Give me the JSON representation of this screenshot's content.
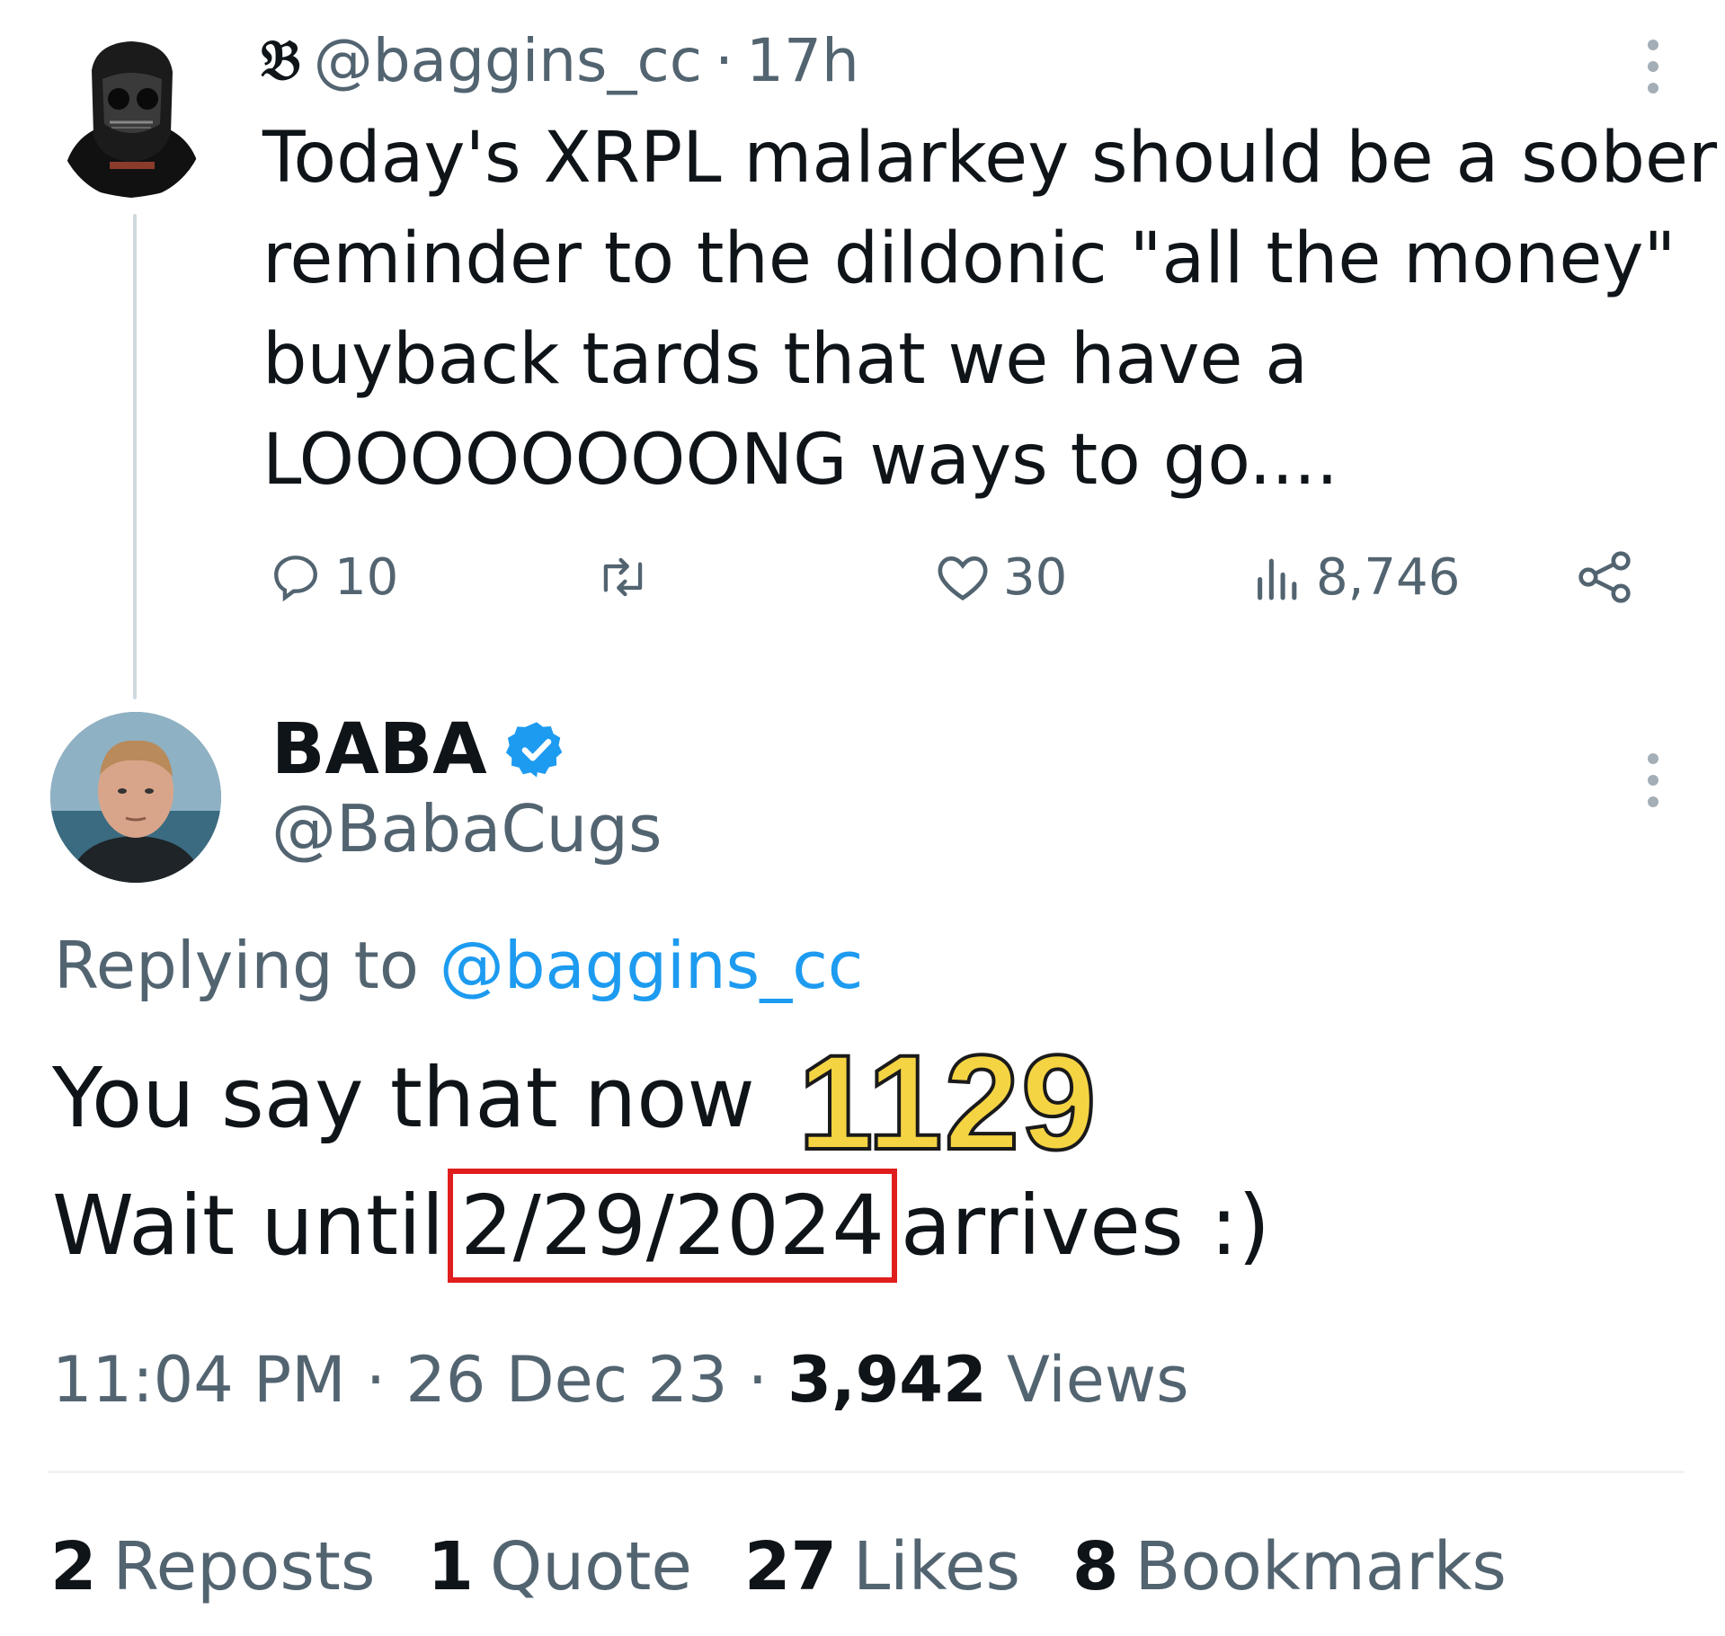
{
  "parent_tweet": {
    "brand_glyph": "𝔅",
    "handle": "@baggins_cc",
    "separator": "·",
    "time_ago": "17h",
    "text_lines": [
      "Today's XRPL malarkey should be a sober",
      "reminder to the dildonic \"all the money\"",
      "buyback tards that we have a",
      "LOOOOOOOONG ways to go...."
    ],
    "actions": {
      "replies": "10",
      "reposts": "",
      "likes": "30",
      "views": "8,746"
    }
  },
  "reply_tweet": {
    "display_name": "BABA",
    "handle": "@BabaCugs",
    "replying_label": "Replying to",
    "replying_mention": "@baggins_cc",
    "text_line_1": "You say that now",
    "overlay_number": "1129",
    "text_line_2_prefix": "Wait until",
    "highlighted_date": "2/29/2024",
    "text_line_2_suffix": "arrives :)",
    "time": "11:04 PM",
    "date": "26 Dec 23",
    "views_count": "3,942",
    "views_label": "Views",
    "stats": [
      {
        "count": "2",
        "label": "Reposts"
      },
      {
        "count": "1",
        "label": "Quote"
      },
      {
        "count": "27",
        "label": "Likes"
      },
      {
        "count": "8",
        "label": "Bookmarks"
      }
    ]
  },
  "colors": {
    "text": "#0f1419",
    "secondary": "#536471",
    "link": "#1d9bf0",
    "verified": "#1d9bf0",
    "highlight_box": "#e01e1e",
    "overlay_fill": "#f5d443"
  }
}
